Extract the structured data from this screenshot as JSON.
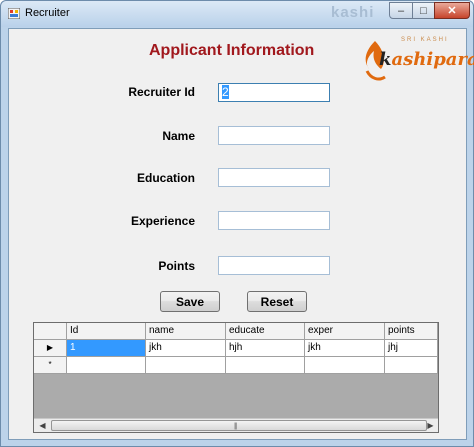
{
  "window": {
    "title": "Recruiter",
    "watermark": "kashi",
    "controls": {
      "minimize": "‒",
      "maximize": "□",
      "close": "✕"
    }
  },
  "form": {
    "heading": "Applicant Information",
    "logo": {
      "text_k": "k",
      "text_rest": "ashipara",
      "sub": "SRI KASHI"
    },
    "fields": [
      {
        "label": "Recruiter Id",
        "value": "2"
      },
      {
        "label": "Name",
        "value": ""
      },
      {
        "label": "Education",
        "value": ""
      },
      {
        "label": "Experience",
        "value": ""
      },
      {
        "label": "Points",
        "value": ""
      }
    ],
    "buttons": {
      "save": "Save",
      "reset": "Reset"
    }
  },
  "grid": {
    "columns": [
      "Id",
      "name",
      "educate",
      "exper",
      "points"
    ],
    "rows": [
      {
        "marker": "▶",
        "cells": [
          "1",
          "jkh",
          "hjh",
          "jkh",
          "jhj"
        ]
      }
    ],
    "new_row_marker": "*",
    "scroll": {
      "left": "◀",
      "right": "▶",
      "grip": "|||"
    }
  },
  "colors": {
    "heading": "#a1181d",
    "selection": "#3399ff",
    "logo": "#e06a0f"
  },
  "icons": [
    "app-icon",
    "minimize-icon",
    "maximize-icon",
    "close-icon",
    "row-pointer-icon"
  ]
}
